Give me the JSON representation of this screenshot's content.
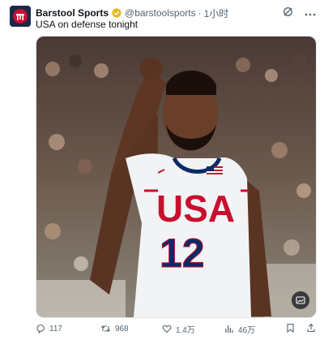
{
  "tweet": {
    "author_name": "Barstool Sports",
    "handle": "@barstoolsports",
    "separator": "·",
    "time": "1小时",
    "text": "USA on defense tonight",
    "verified_badge_color": "#e8b923",
    "photo": {
      "jersey_text": "USA",
      "jersey_number": "12",
      "jersey_color": "#f2f3f5",
      "lettering_color": "#c8102e",
      "number_color": "#0a2a66"
    }
  },
  "actions": {
    "reply_count": "117",
    "retweet_count": "968",
    "like_count": "1.4万",
    "view_count": "46万"
  },
  "icons": [
    "verified-badge-icon",
    "grok-icon",
    "more-icon",
    "alt-text-icon",
    "reply-icon",
    "retweet-icon",
    "like-icon",
    "views-icon",
    "bookmark-icon",
    "share-icon"
  ]
}
